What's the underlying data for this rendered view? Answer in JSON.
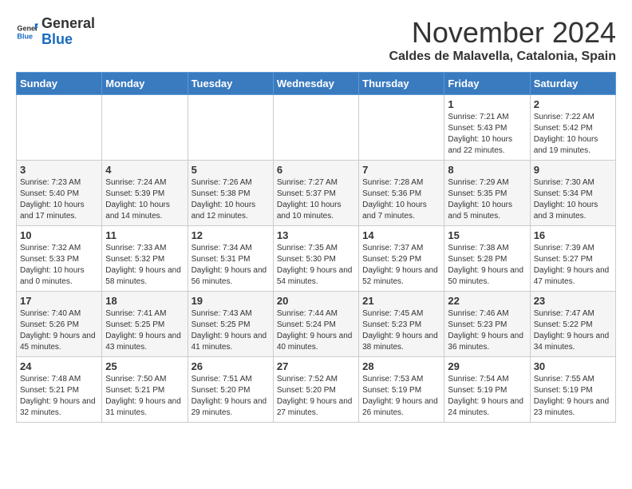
{
  "header": {
    "logo_general": "General",
    "logo_blue": "Blue",
    "month_title": "November 2024",
    "location": "Caldes de Malavella, Catalonia, Spain"
  },
  "calendar": {
    "weekdays": [
      "Sunday",
      "Monday",
      "Tuesday",
      "Wednesday",
      "Thursday",
      "Friday",
      "Saturday"
    ],
    "weeks": [
      [
        {
          "day": "",
          "info": ""
        },
        {
          "day": "",
          "info": ""
        },
        {
          "day": "",
          "info": ""
        },
        {
          "day": "",
          "info": ""
        },
        {
          "day": "",
          "info": ""
        },
        {
          "day": "1",
          "info": "Sunrise: 7:21 AM\nSunset: 5:43 PM\nDaylight: 10 hours and 22 minutes."
        },
        {
          "day": "2",
          "info": "Sunrise: 7:22 AM\nSunset: 5:42 PM\nDaylight: 10 hours and 19 minutes."
        }
      ],
      [
        {
          "day": "3",
          "info": "Sunrise: 7:23 AM\nSunset: 5:40 PM\nDaylight: 10 hours and 17 minutes."
        },
        {
          "day": "4",
          "info": "Sunrise: 7:24 AM\nSunset: 5:39 PM\nDaylight: 10 hours and 14 minutes."
        },
        {
          "day": "5",
          "info": "Sunrise: 7:26 AM\nSunset: 5:38 PM\nDaylight: 10 hours and 12 minutes."
        },
        {
          "day": "6",
          "info": "Sunrise: 7:27 AM\nSunset: 5:37 PM\nDaylight: 10 hours and 10 minutes."
        },
        {
          "day": "7",
          "info": "Sunrise: 7:28 AM\nSunset: 5:36 PM\nDaylight: 10 hours and 7 minutes."
        },
        {
          "day": "8",
          "info": "Sunrise: 7:29 AM\nSunset: 5:35 PM\nDaylight: 10 hours and 5 minutes."
        },
        {
          "day": "9",
          "info": "Sunrise: 7:30 AM\nSunset: 5:34 PM\nDaylight: 10 hours and 3 minutes."
        }
      ],
      [
        {
          "day": "10",
          "info": "Sunrise: 7:32 AM\nSunset: 5:33 PM\nDaylight: 10 hours and 0 minutes."
        },
        {
          "day": "11",
          "info": "Sunrise: 7:33 AM\nSunset: 5:32 PM\nDaylight: 9 hours and 58 minutes."
        },
        {
          "day": "12",
          "info": "Sunrise: 7:34 AM\nSunset: 5:31 PM\nDaylight: 9 hours and 56 minutes."
        },
        {
          "day": "13",
          "info": "Sunrise: 7:35 AM\nSunset: 5:30 PM\nDaylight: 9 hours and 54 minutes."
        },
        {
          "day": "14",
          "info": "Sunrise: 7:37 AM\nSunset: 5:29 PM\nDaylight: 9 hours and 52 minutes."
        },
        {
          "day": "15",
          "info": "Sunrise: 7:38 AM\nSunset: 5:28 PM\nDaylight: 9 hours and 50 minutes."
        },
        {
          "day": "16",
          "info": "Sunrise: 7:39 AM\nSunset: 5:27 PM\nDaylight: 9 hours and 47 minutes."
        }
      ],
      [
        {
          "day": "17",
          "info": "Sunrise: 7:40 AM\nSunset: 5:26 PM\nDaylight: 9 hours and 45 minutes."
        },
        {
          "day": "18",
          "info": "Sunrise: 7:41 AM\nSunset: 5:25 PM\nDaylight: 9 hours and 43 minutes."
        },
        {
          "day": "19",
          "info": "Sunrise: 7:43 AM\nSunset: 5:25 PM\nDaylight: 9 hours and 41 minutes."
        },
        {
          "day": "20",
          "info": "Sunrise: 7:44 AM\nSunset: 5:24 PM\nDaylight: 9 hours and 40 minutes."
        },
        {
          "day": "21",
          "info": "Sunrise: 7:45 AM\nSunset: 5:23 PM\nDaylight: 9 hours and 38 minutes."
        },
        {
          "day": "22",
          "info": "Sunrise: 7:46 AM\nSunset: 5:23 PM\nDaylight: 9 hours and 36 minutes."
        },
        {
          "day": "23",
          "info": "Sunrise: 7:47 AM\nSunset: 5:22 PM\nDaylight: 9 hours and 34 minutes."
        }
      ],
      [
        {
          "day": "24",
          "info": "Sunrise: 7:48 AM\nSunset: 5:21 PM\nDaylight: 9 hours and 32 minutes."
        },
        {
          "day": "25",
          "info": "Sunrise: 7:50 AM\nSunset: 5:21 PM\nDaylight: 9 hours and 31 minutes."
        },
        {
          "day": "26",
          "info": "Sunrise: 7:51 AM\nSunset: 5:20 PM\nDaylight: 9 hours and 29 minutes."
        },
        {
          "day": "27",
          "info": "Sunrise: 7:52 AM\nSunset: 5:20 PM\nDaylight: 9 hours and 27 minutes."
        },
        {
          "day": "28",
          "info": "Sunrise: 7:53 AM\nSunset: 5:19 PM\nDaylight: 9 hours and 26 minutes."
        },
        {
          "day": "29",
          "info": "Sunrise: 7:54 AM\nSunset: 5:19 PM\nDaylight: 9 hours and 24 minutes."
        },
        {
          "day": "30",
          "info": "Sunrise: 7:55 AM\nSunset: 5:19 PM\nDaylight: 9 hours and 23 minutes."
        }
      ]
    ]
  }
}
